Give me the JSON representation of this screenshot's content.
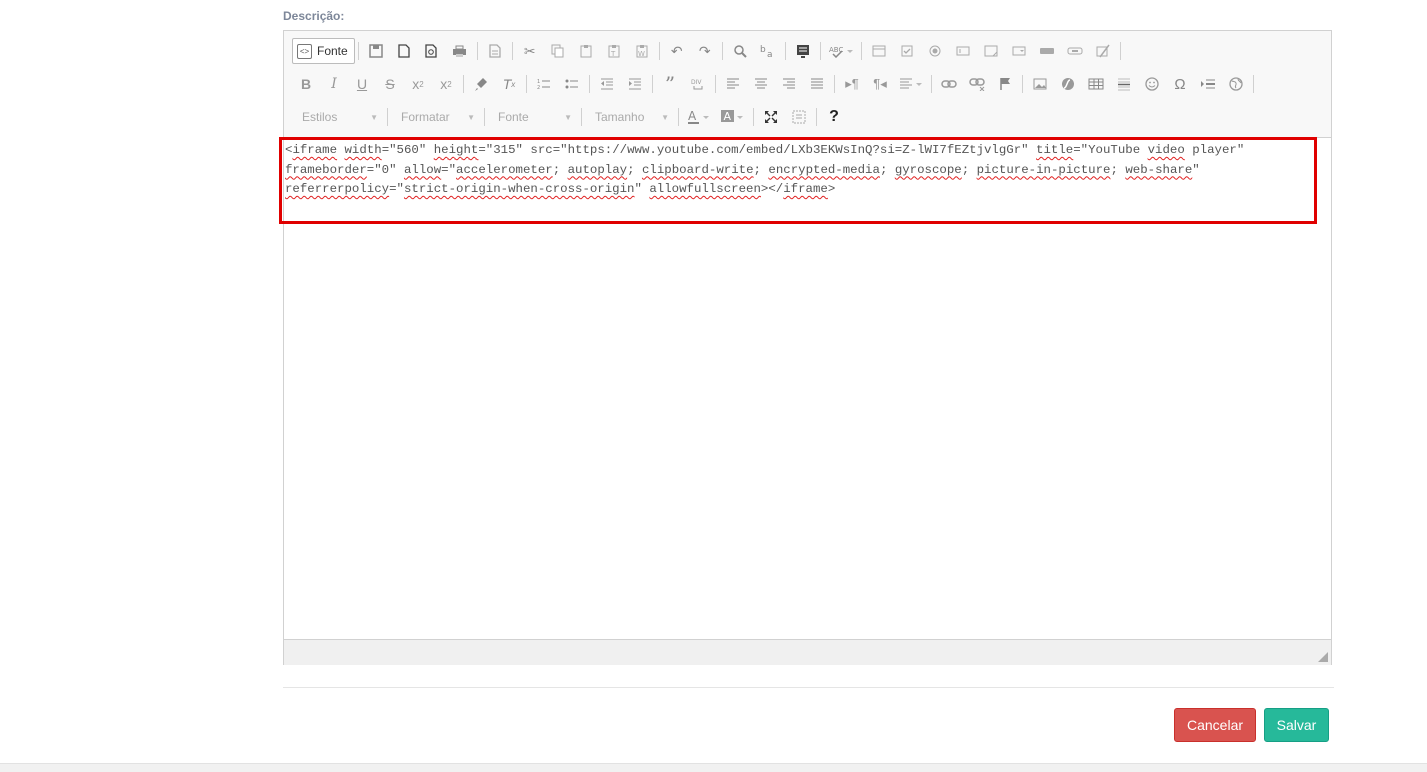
{
  "form": {
    "description_label": "Descrição:"
  },
  "toolbar": {
    "source_label": "Fonte",
    "combos": {
      "styles": "Estilos",
      "format": "Formatar",
      "font": "Fonte",
      "size": "Tamanho"
    },
    "help_label": "?"
  },
  "editor": {
    "source_segments": [
      {
        "t": "<",
        "w": false
      },
      {
        "t": "iframe",
        "w": true
      },
      {
        "t": " ",
        "w": false
      },
      {
        "t": "width",
        "w": true
      },
      {
        "t": "=\"560\" ",
        "w": false
      },
      {
        "t": "height",
        "w": true
      },
      {
        "t": "=\"315\" src=\"https://www.youtube.com/embed/LXb3EKWsInQ?si=Z-lWI7fEZtjvlgGr\" ",
        "w": false
      },
      {
        "t": "title",
        "w": true
      },
      {
        "t": "=\"YouTube ",
        "w": false
      },
      {
        "t": "video",
        "w": true
      },
      {
        "t": " player\" ",
        "w": false
      },
      {
        "t": "frameborder",
        "w": true
      },
      {
        "t": "=\"0\" ",
        "w": false
      },
      {
        "t": "allow",
        "w": true
      },
      {
        "t": "=\"",
        "w": false
      },
      {
        "t": "accelerometer",
        "w": true
      },
      {
        "t": "; ",
        "w": false
      },
      {
        "t": "autoplay",
        "w": true
      },
      {
        "t": "; ",
        "w": false
      },
      {
        "t": "clipboard-write",
        "w": true
      },
      {
        "t": "; ",
        "w": false
      },
      {
        "t": "encrypted-media",
        "w": true
      },
      {
        "t": "; ",
        "w": false
      },
      {
        "t": "gyroscope",
        "w": true
      },
      {
        "t": "; ",
        "w": false
      },
      {
        "t": "picture-in-picture",
        "w": true
      },
      {
        "t": "; ",
        "w": false
      },
      {
        "t": "web-share",
        "w": true
      },
      {
        "t": "\" ",
        "w": false
      },
      {
        "t": "referrerpolicy",
        "w": true
      },
      {
        "t": "=\"",
        "w": false
      },
      {
        "t": "strict-origin-when-cross-origin",
        "w": true
      },
      {
        "t": "\" ",
        "w": false
      },
      {
        "t": "allowfullscreen",
        "w": true
      },
      {
        "t": "></",
        "w": false
      },
      {
        "t": "iframe",
        "w": true
      },
      {
        "t": ">",
        "w": false
      }
    ]
  },
  "actions": {
    "cancel_label": "Cancelar",
    "save_label": "Salvar"
  },
  "colors": {
    "cancel_bg": "#d9534f",
    "save_bg": "#26b99a",
    "highlight_border": "#e00000",
    "label_text": "#7d8799"
  }
}
